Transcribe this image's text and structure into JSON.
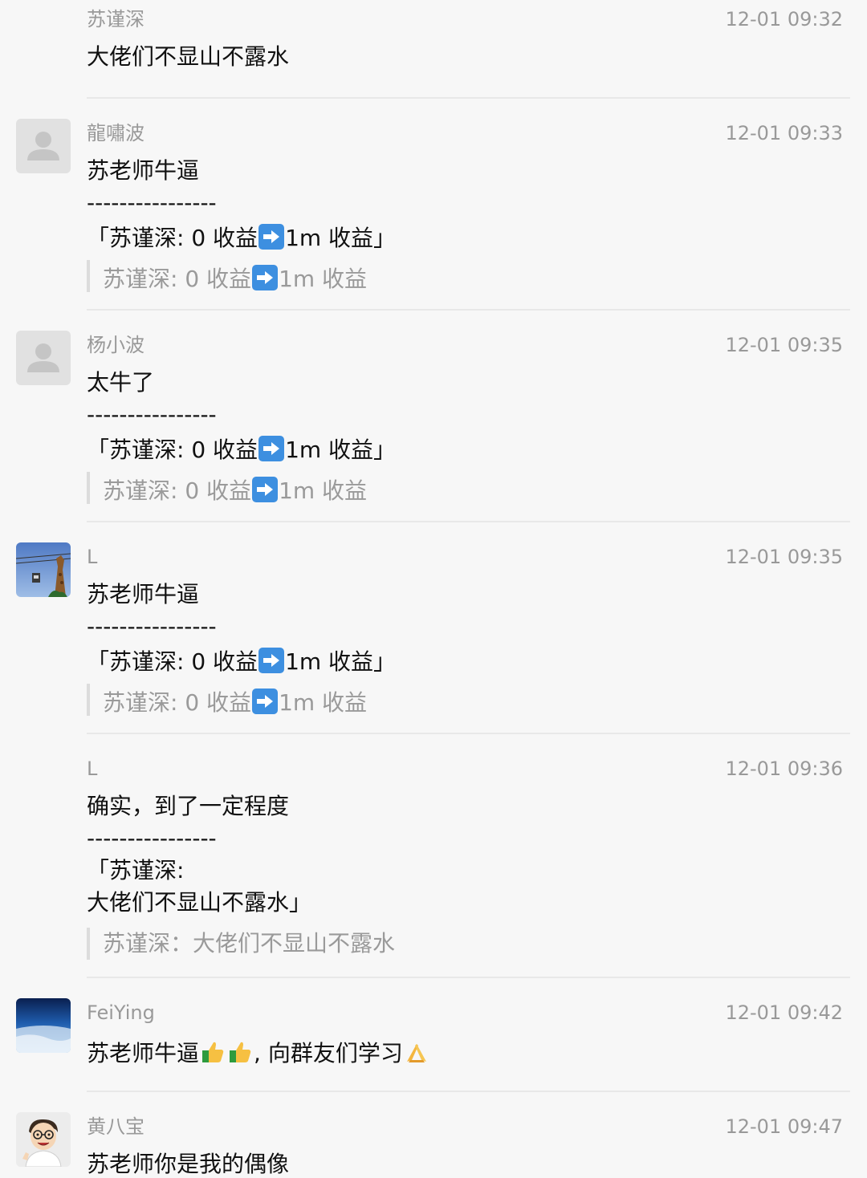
{
  "messages": [
    {
      "name": "苏谨深",
      "time": "12-01 09:32",
      "text": "大佬们不显山不露水",
      "avatar": "none"
    },
    {
      "name": "龍嘯波",
      "time": "12-01 09:33",
      "text": "苏老师牛逼",
      "separator": "----------------",
      "quoted_pre": "「苏谨深: 0 收益",
      "quoted_post": "1m 收益」",
      "quote_pre": "苏谨深: 0 收益",
      "quote_post": "1m 收益",
      "avatar": "default-person-icon"
    },
    {
      "name": "杨小波",
      "time": "12-01 09:35",
      "text": "太牛了",
      "separator": "----------------",
      "quoted_pre": "「苏谨深: 0 收益",
      "quoted_post": "1m 收益」",
      "quote_pre": "苏谨深: 0 收益",
      "quote_post": "1m 收益",
      "avatar": "default-person-icon"
    },
    {
      "name": "L",
      "time": "12-01 09:35",
      "text": "苏老师牛逼",
      "separator": "----------------",
      "quoted_pre": "「苏谨深: 0 收益",
      "quoted_post": "1m 收益」",
      "quote_pre": "苏谨深: 0 收益",
      "quote_post": "1m 收益",
      "avatar": "giraffe-cable-car-photo"
    },
    {
      "name": "L",
      "time": "12-01 09:36",
      "text": "确实，到了一定程度",
      "separator": "----------------",
      "quoted_line1": "「苏谨深:",
      "quoted_line2": "大佬们不显山不露水」",
      "quote": "苏谨深：大佬们不显山不露水",
      "avatar": "none"
    },
    {
      "name": "FeiYing",
      "time": "12-01 09:42",
      "text_pre": "苏老师牛逼",
      "text_post": ", 向群友们学习",
      "avatar": "sky-earth-photo"
    },
    {
      "name": "黄八宝",
      "time": "12-01 09:47",
      "text": "苏老师你是我的偶像",
      "avatar": "cartoon-man-with-glasses"
    }
  ],
  "icons": {
    "arrow": "right-arrow-emoji",
    "thumb": "thumbs-up-emoji",
    "pray": "folded-hands-emoji"
  },
  "colors": {
    "background": "#f7f7f7",
    "name": "#999999",
    "text": "#111111",
    "quote": "#9a9a9a",
    "divider": "#e8e8e8"
  }
}
